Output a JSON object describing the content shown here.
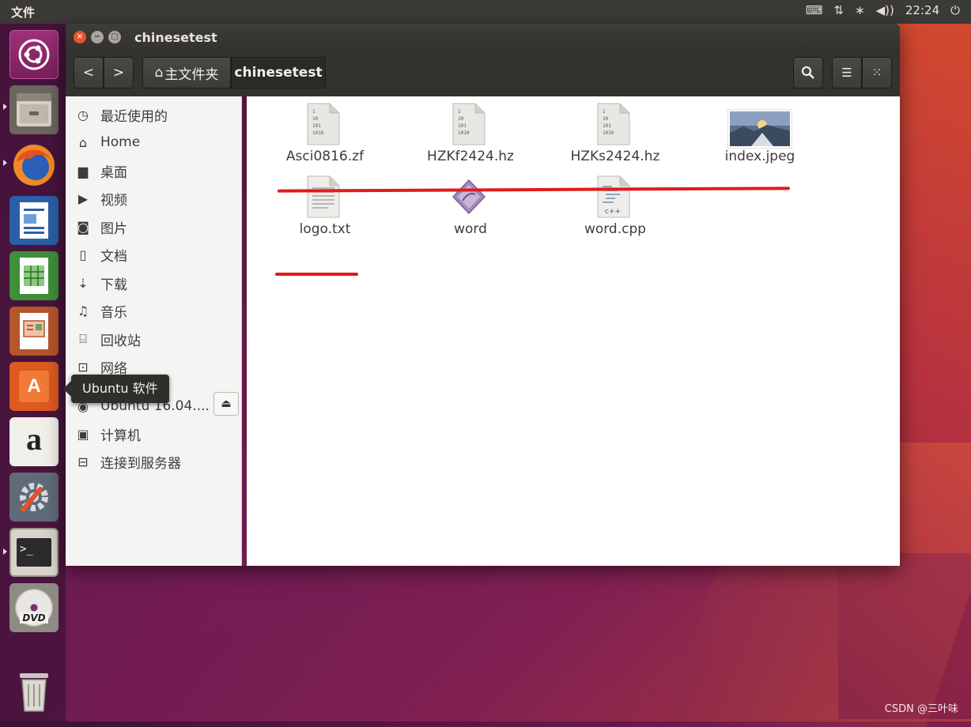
{
  "top_panel": {
    "app_menu": "文件",
    "indicators": [
      "⌨",
      "⇅",
      "∗",
      "◀))",
      "⏻"
    ],
    "clock": "22:24"
  },
  "launcher": {
    "items": [
      {
        "name": "ubuntu-dash",
        "active": false
      },
      {
        "name": "files",
        "active": true
      },
      {
        "name": "firefox",
        "active": true
      },
      {
        "name": "libreoffice-writer",
        "active": false
      },
      {
        "name": "libreoffice-calc",
        "active": false
      },
      {
        "name": "libreoffice-impress",
        "active": false
      },
      {
        "name": "ubuntu-software",
        "active": false
      },
      {
        "name": "amazon",
        "active": false
      },
      {
        "name": "system-settings",
        "active": false
      },
      {
        "name": "terminal",
        "active": true
      },
      {
        "name": "dvd",
        "active": false
      },
      {
        "name": "trash",
        "active": false
      }
    ],
    "amazon_glyph": "a",
    "software_glyph": "A",
    "terminal_glyph": ">_",
    "dvd_glyph": "DVD"
  },
  "window": {
    "title": "chinesetest",
    "close_glyph": "×",
    "minimize_glyph": "−",
    "maximize_glyph": "□"
  },
  "toolbar": {
    "back_glyph": "<",
    "forward_glyph": ">",
    "home_crumb": "主文件夹",
    "home_glyph": "⌂",
    "current_crumb": "chinesetest",
    "search_glyph": "⌕",
    "list_view_glyph": "☰",
    "grid_view_glyph": "⁙"
  },
  "sidebar": {
    "items": [
      {
        "icon": "clock-icon",
        "glyph": "◷",
        "label": "最近使用的"
      },
      {
        "icon": "home-icon",
        "glyph": "⌂",
        "label": "Home"
      },
      {
        "icon": "folder-icon",
        "glyph": "▆",
        "label": "桌面"
      },
      {
        "icon": "video-icon",
        "glyph": "▶",
        "label": "视频"
      },
      {
        "icon": "camera-icon",
        "glyph": "◙",
        "label": "图片"
      },
      {
        "icon": "document-icon",
        "glyph": "▯",
        "label": "文档"
      },
      {
        "icon": "download-icon",
        "glyph": "⇣",
        "label": "下载"
      },
      {
        "icon": "music-icon",
        "glyph": "♫",
        "label": "音乐"
      },
      {
        "icon": "trash-icon",
        "glyph": "⌸",
        "label": "回收站"
      },
      {
        "icon": "network-icon",
        "glyph": "⊡",
        "label": "网络"
      },
      {
        "icon": "disc-icon",
        "glyph": "◉",
        "label": "Ubuntu 16.04...."
      },
      {
        "icon": "computer-icon",
        "glyph": "▣",
        "label": "计算机"
      },
      {
        "icon": "server-icon",
        "glyph": "⊟",
        "label": "连接到服务器"
      }
    ],
    "eject_glyph": "⏏"
  },
  "files": [
    {
      "name": "Asci0816.zf",
      "type": "binary"
    },
    {
      "name": "HZKf2424.hz",
      "type": "binary"
    },
    {
      "name": "HZKs2424.hz",
      "type": "binary"
    },
    {
      "name": "index.jpeg",
      "type": "image"
    },
    {
      "name": "logo.txt",
      "type": "text"
    },
    {
      "name": "word",
      "type": "executable"
    },
    {
      "name": "word.cpp",
      "type": "cpp"
    }
  ],
  "binary_icon_lines": [
    "1",
    "10",
    "101",
    "1010"
  ],
  "cpp_icon_label": "c++",
  "tooltip": "Ubuntu 软件",
  "watermark": "CSDN @三叶味",
  "colors": {
    "accent_underline": "#e01b1b",
    "close_button": "#e9542f",
    "panel": "#3b3a36"
  }
}
